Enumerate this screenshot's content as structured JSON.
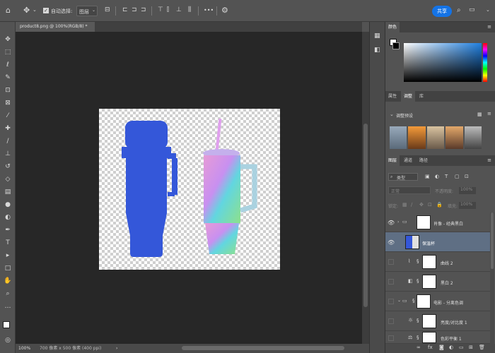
{
  "options_bar": {
    "auto_select_label": "自动选择:",
    "auto_select_checked": true,
    "auto_select_target": "图层",
    "share_label": "共享",
    "more_label": "•••"
  },
  "document": {
    "tab_title": "product8.png @ 100%(RGB/8) *",
    "close": "×"
  },
  "status": {
    "zoom": "100%",
    "dimensions": "700 像素 x 500 像素 (400 ppi)"
  },
  "panels": {
    "color_tab": "颜色",
    "tabs_2": [
      "属性",
      "调整",
      "库"
    ],
    "active_tab_2": "调整",
    "adj_presets": "调整预设",
    "tabs_3": [
      "图层",
      "通道",
      "路径"
    ],
    "active_tab_3": "图层",
    "filter_kind": "类型",
    "blend_mode": "正常",
    "opacity_label": "不透明度:",
    "opacity_value": "100%",
    "lock_label": "锁定:",
    "fill_label": "填充:",
    "fill_value": "100%"
  },
  "layers": [
    {
      "name": "肖像 - 经典黑白",
      "visible": true,
      "kind": "group"
    },
    {
      "name": "保温杯",
      "visible": true,
      "kind": "image",
      "selected": true
    },
    {
      "name": "曲线 2",
      "visible": false,
      "kind": "curves"
    },
    {
      "name": "黑白 2",
      "visible": false,
      "kind": "bw"
    },
    {
      "name": "电影 - 分离色调",
      "visible": false,
      "kind": "group"
    },
    {
      "name": "亮度/对比度 1",
      "visible": false,
      "kind": "brightness"
    },
    {
      "name": "色彩平衡 1",
      "visible": false,
      "kind": "balance"
    }
  ],
  "colors": {
    "flask_blue": "#3457d9",
    "share_blue": "#1473e6",
    "tumbler_pink": "#d08be6",
    "tumbler_teal": "#5fd3c9"
  }
}
